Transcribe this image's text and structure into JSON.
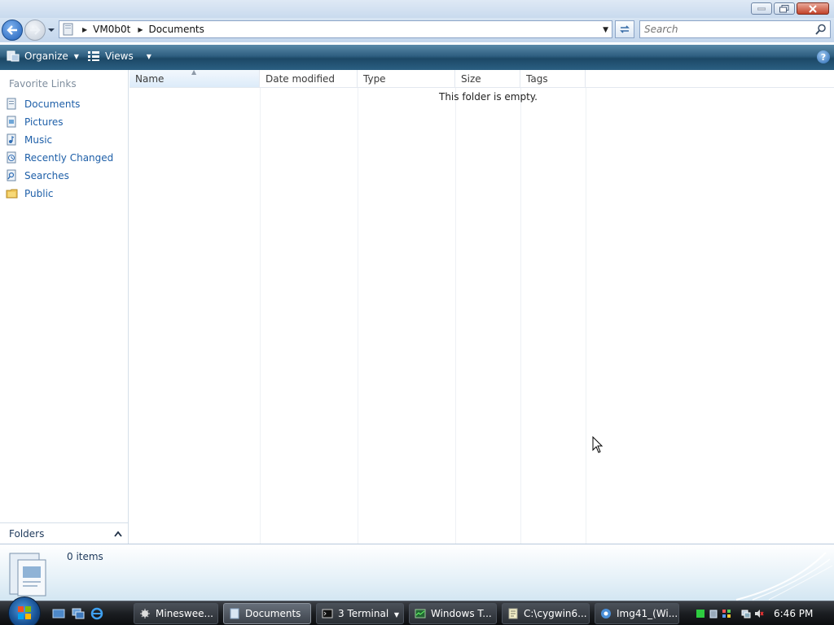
{
  "window": {
    "buttons": {
      "minimize": "minimize",
      "maximize": "maximize",
      "close": "close"
    }
  },
  "address": {
    "breadcrumbs": [
      "VM0b0t",
      "Documents"
    ]
  },
  "search": {
    "placeholder": "Search"
  },
  "commandbar": {
    "organize_label": "Organize",
    "views_label": "Views",
    "help_label": "?"
  },
  "navpane": {
    "heading": "Favorite Links",
    "items": [
      {
        "label": "Documents",
        "icon": "documents-icon"
      },
      {
        "label": "Pictures",
        "icon": "pictures-icon"
      },
      {
        "label": "Music",
        "icon": "music-icon"
      },
      {
        "label": "Recently Changed",
        "icon": "recently-changed-icon"
      },
      {
        "label": "Searches",
        "icon": "searches-icon"
      },
      {
        "label": "Public",
        "icon": "public-folder-icon"
      }
    ],
    "folders_label": "Folders"
  },
  "filelist": {
    "columns": [
      "Name",
      "Date modified",
      "Type",
      "Size",
      "Tags"
    ],
    "empty_message": "This folder is empty."
  },
  "details": {
    "item_count": "0 items"
  },
  "taskbar": {
    "tasks": [
      {
        "label": "Mineswee...",
        "icon": "minesweeper-icon"
      },
      {
        "label": "Documents",
        "icon": "explorer-icon",
        "active": true
      },
      {
        "label": "3 Terminal",
        "icon": "terminal-icon"
      },
      {
        "label": "Windows T...",
        "icon": "task-manager-icon"
      },
      {
        "label": "C:\\cygwin6...",
        "icon": "notepad-icon"
      },
      {
        "label": "Img41_(Wi...",
        "icon": "chrome-icon"
      }
    ],
    "clock": "6:46 PM"
  },
  "colors": {
    "link_blue": "#1e5fa8",
    "command_bar": "#2e5e80",
    "taskbar": "#1b1e22"
  }
}
